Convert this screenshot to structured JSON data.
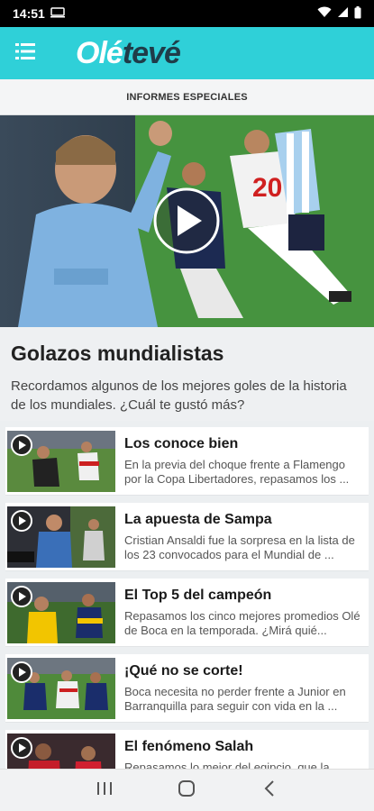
{
  "status": {
    "time": "14:51"
  },
  "header": {
    "logo_part1": "Olé",
    "logo_part2": "tevé"
  },
  "section": {
    "label": "INFORMES ESPECIALES"
  },
  "feature": {
    "title": "Golazos mundialistas",
    "description": "Recordamos algunos de los mejores goles de la historia de los mundiales. ¿Cuál te gustó más?"
  },
  "items": [
    {
      "title": "Los conoce bien",
      "description": "En la previa del choque frente a Flamengo por la Copa Libertadores, repasamos los ..."
    },
    {
      "title": "La apuesta de Sampa",
      "description": "Cristian Ansaldi fue la sorpresa en la lista de los 23 convocados para el Mundial de ..."
    },
    {
      "title": "El Top 5 del campeón",
      "description": "Repasamos los cinco mejores promedios Olé de Boca en la temporada. ¿Mirá quié..."
    },
    {
      "title": "¡Qué no se corte!",
      "description": "Boca necesita no perder frente a Junior en Barranquilla para seguir con vida en la ..."
    },
    {
      "title": "El fenómeno Salah",
      "description": "Repasamos lo mejor del egipcio, que la ..."
    }
  ],
  "colors": {
    "brand": "#2fd0d8",
    "brand_dark": "#1f3c49"
  }
}
